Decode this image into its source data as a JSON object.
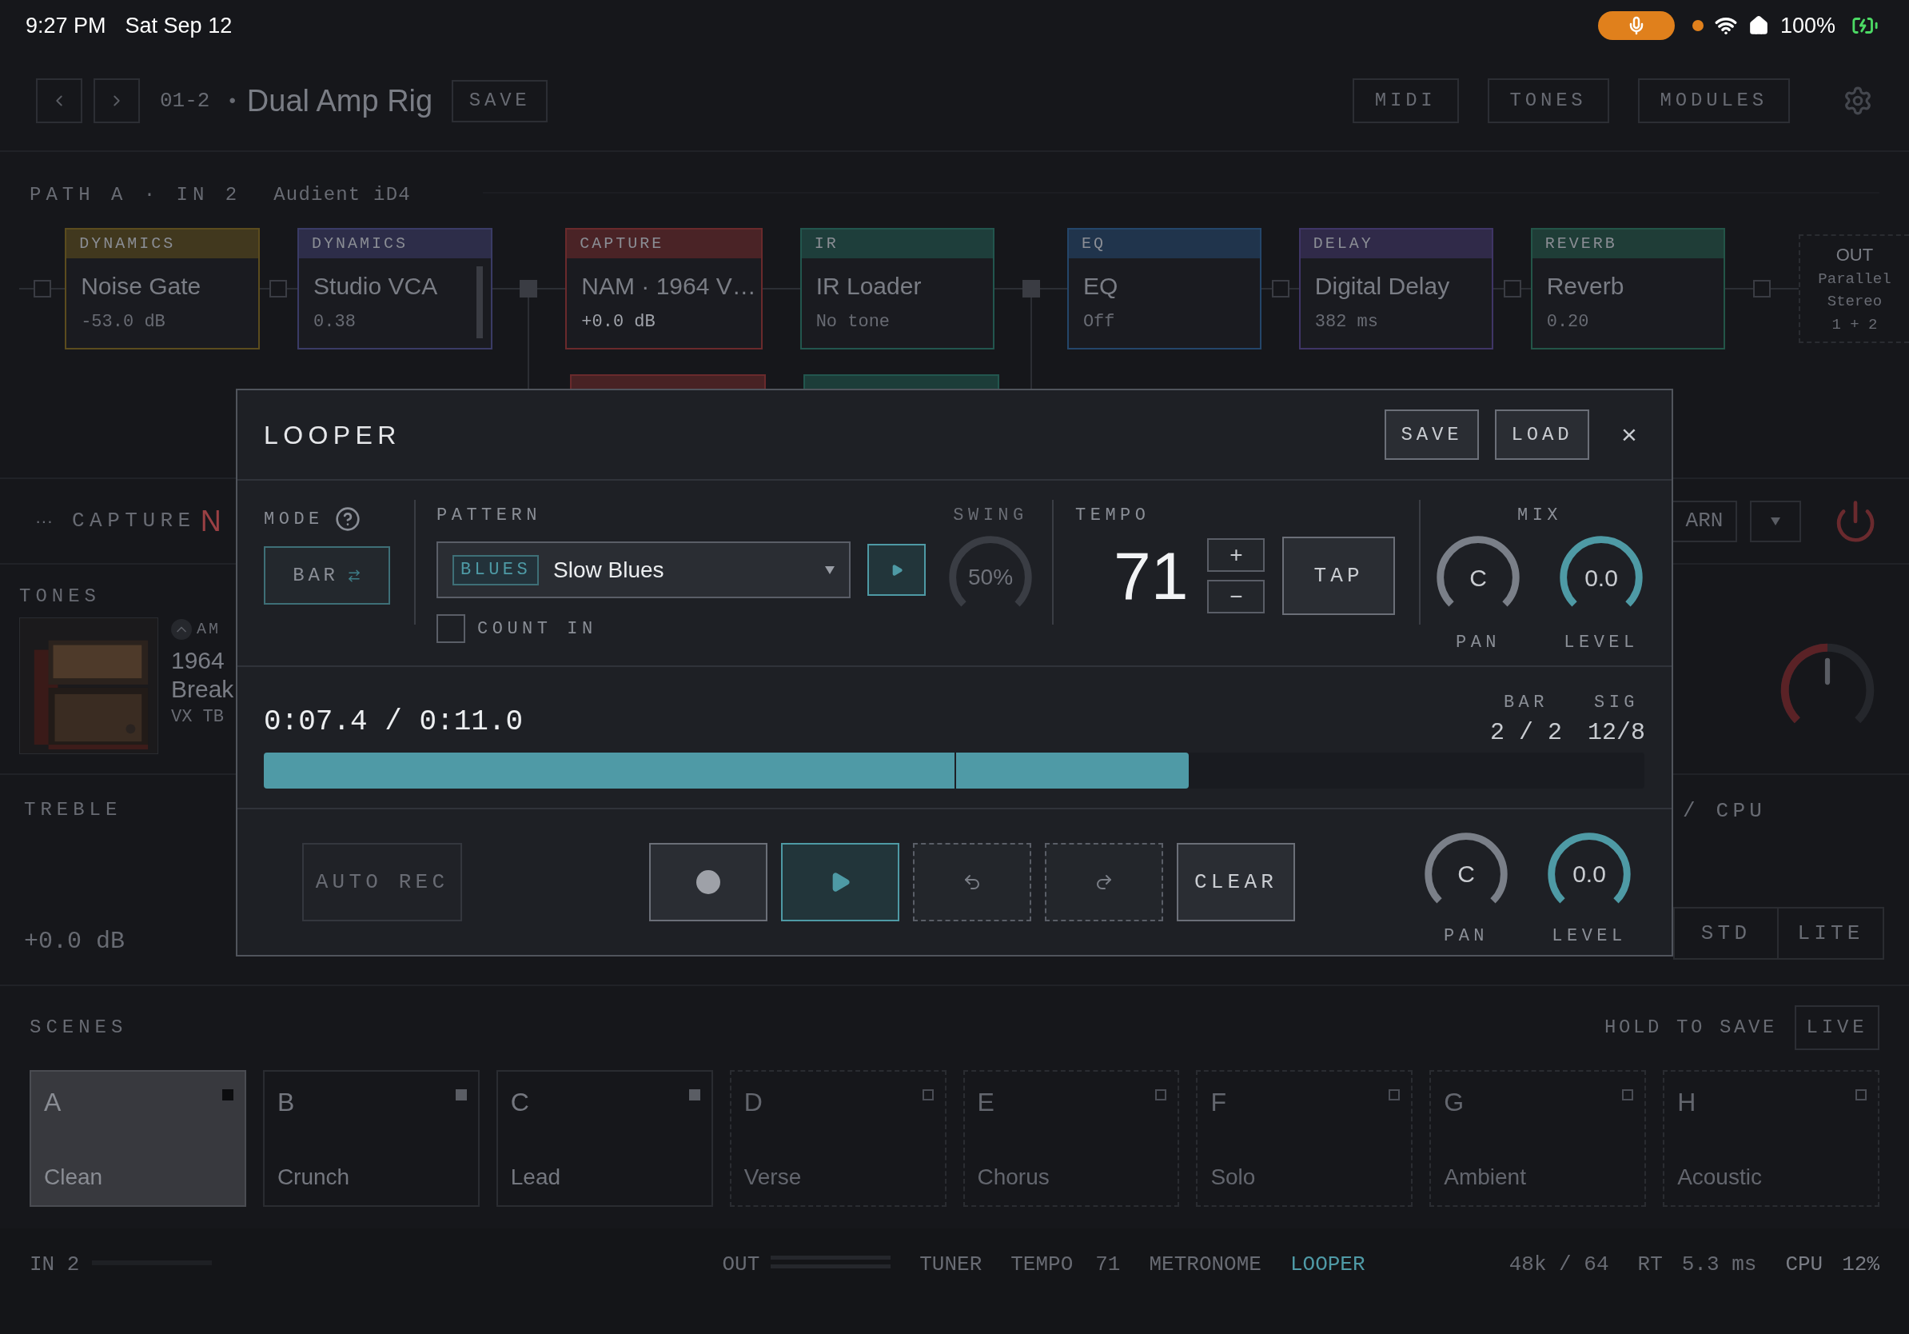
{
  "status_bar": {
    "time": "9:27 PM",
    "date": "Sat Sep 12",
    "battery": "100%"
  },
  "header": {
    "preset_number": "01-2",
    "separator": "•",
    "preset_name": "Dual Amp Rig",
    "save": "SAVE",
    "buttons": [
      "MIDI",
      "TONES",
      "MODULES"
    ]
  },
  "path": {
    "label": "PATH A · IN 2",
    "device": "Audient iD4"
  },
  "chain": [
    {
      "category": "DYNAMICS",
      "title": "Noise Gate",
      "value": "-53.0 dB",
      "color": "#5b4c1e",
      "selected": false
    },
    {
      "category": "DYNAMICS",
      "title": "Studio VCA",
      "value": "0.38",
      "color": "#3a3b66",
      "selected": false
    },
    {
      "category": "CAPTURE",
      "title": "NAM · 1964 V…",
      "value": "+0.0 dB",
      "color": "#6a2a2c",
      "selected": true
    },
    {
      "category": "IR",
      "title": "IR Loader",
      "value": "No tone",
      "color": "#22564e",
      "selected": false
    },
    {
      "category": "EQ",
      "title": "EQ",
      "value": "Off",
      "color": "#24466a",
      "selected": false
    },
    {
      "category": "DELAY",
      "title": "Digital Delay",
      "value": "382 ms",
      "color": "#3f3566",
      "selected": false
    },
    {
      "category": "REVERB",
      "title": "Reverb",
      "value": "0.20",
      "color": "#235548",
      "selected": false
    }
  ],
  "chain_out": {
    "label": "OUT",
    "mode": "Parallel",
    "routing": "Stereo",
    "channels": "1 + 2"
  },
  "chain_parallel": [
    {
      "color": "#6a2a2c"
    },
    {
      "color": "#22564e"
    }
  ],
  "module": {
    "more": "···",
    "label": "CAPTURE",
    "name": "N",
    "learn": "ARN"
  },
  "tones": {
    "label": "TONES",
    "category": "AM",
    "title_line_1": "1964",
    "title_line_2": "Break",
    "subtitle": "VX TB"
  },
  "side_knob": {
    "level": 0.5
  },
  "treble": {
    "label": "TREBLE",
    "value": "+0.0 dB"
  },
  "cpu_label": "/ CPU",
  "quality": [
    "STD",
    "LITE"
  ],
  "looper": {
    "title": "LOOPER",
    "save": "SAVE",
    "load": "LOAD",
    "close": "×",
    "mode": {
      "label": "MODE",
      "value": "BAR"
    },
    "pattern": {
      "label": "PATTERN",
      "tag": "BLUES",
      "value": "Slow Blues"
    },
    "count_in": {
      "label": "COUNT IN",
      "checked": false
    },
    "swing": {
      "label": "SWING",
      "value": "50%",
      "disabled": true
    },
    "tempo": {
      "label": "TEMPO",
      "value": "71",
      "plus": "+",
      "minus": "−",
      "tap": "TAP"
    },
    "mix": {
      "label": "MIX",
      "pan": {
        "label": "PAN",
        "value": "C"
      },
      "level": {
        "label": "LEVEL",
        "value": "0.0"
      }
    },
    "time": "0:07.4 / 0:11.0",
    "bar": {
      "label": "BAR",
      "value": "2 / 2"
    },
    "sig": {
      "label": "SIG",
      "value": "12/8"
    },
    "progress": {
      "level": 0.67
    },
    "auto_rec": {
      "label": "AUTO REC",
      "disabled": true
    },
    "transport": [
      {
        "kind": "record",
        "selected": false,
        "disabled": false
      },
      {
        "kind": "play",
        "selected": true,
        "disabled": false
      },
      {
        "kind": "undo",
        "selected": false,
        "disabled": true
      },
      {
        "kind": "redo",
        "selected": false,
        "disabled": true
      }
    ],
    "clear": "CLEAR",
    "output": {
      "pan": {
        "label": "PAN",
        "value": "C"
      },
      "level": {
        "label": "LEVEL",
        "value": "0.0"
      }
    }
  },
  "scenes": {
    "label": "SCENES",
    "hint": "HOLD TO SAVE",
    "live": "LIVE",
    "items": [
      {
        "letter": "A",
        "name": "Clean",
        "selected": true,
        "saved": true
      },
      {
        "letter": "B",
        "name": "Crunch",
        "selected": false,
        "saved": true
      },
      {
        "letter": "C",
        "name": "Lead",
        "selected": false,
        "saved": true
      },
      {
        "letter": "D",
        "name": "Verse",
        "selected": false,
        "saved": false
      },
      {
        "letter": "E",
        "name": "Chorus",
        "selected": false,
        "saved": false
      },
      {
        "letter": "F",
        "name": "Solo",
        "selected": false,
        "saved": false
      },
      {
        "letter": "G",
        "name": "Ambient",
        "selected": false,
        "saved": false
      },
      {
        "letter": "H",
        "name": "Acoustic",
        "selected": false,
        "saved": false
      }
    ]
  },
  "footer": {
    "input": "IN 2",
    "output": "OUT",
    "tuner": {
      "label": "TUNER",
      "on": false
    },
    "tempo": {
      "label": "TEMPO",
      "value": "71"
    },
    "metronome": {
      "label": "METRONOME",
      "on": false
    },
    "looper": {
      "label": "LOOPER",
      "on": true
    },
    "rate": "48k / 64",
    "rt": {
      "label": "RT",
      "value": "5.3 ms"
    },
    "cpu": {
      "label": "CPU",
      "value": "12%"
    }
  }
}
